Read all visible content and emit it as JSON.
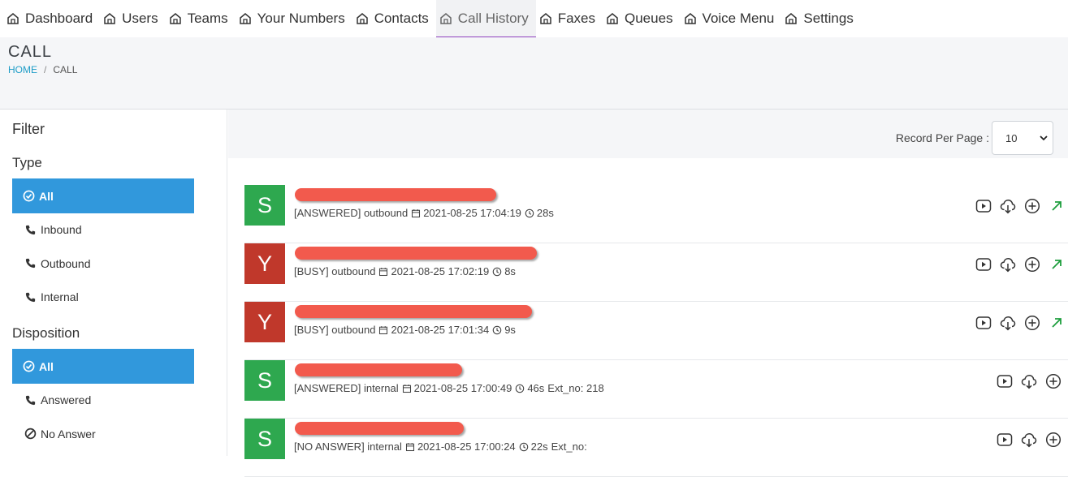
{
  "nav": {
    "items": [
      {
        "label": "Dashboard",
        "active": false
      },
      {
        "label": "Users",
        "active": false
      },
      {
        "label": "Teams",
        "active": false
      },
      {
        "label": "Your Numbers",
        "active": false
      },
      {
        "label": "Contacts",
        "active": false
      },
      {
        "label": "Call History",
        "active": true
      },
      {
        "label": "Faxes",
        "active": false
      },
      {
        "label": "Queues",
        "active": false
      },
      {
        "label": "Voice Menu",
        "active": false
      },
      {
        "label": "Settings",
        "active": false
      }
    ],
    "accent": "#8e3fbe"
  },
  "header": {
    "title": "CALL",
    "breadcrumb": {
      "home": "HOME",
      "separator": "/",
      "current": "CALL"
    }
  },
  "sidebar": {
    "filter_title": "Filter",
    "type": {
      "heading": "Type",
      "items": [
        {
          "label": "All",
          "icon": "check-circle-icon",
          "selected": true
        },
        {
          "label": "Inbound",
          "icon": "phone-icon",
          "selected": false
        },
        {
          "label": "Outbound",
          "icon": "phone-icon",
          "selected": false
        },
        {
          "label": "Internal",
          "icon": "phone-icon",
          "selected": false
        }
      ]
    },
    "disposition": {
      "heading": "Disposition",
      "items": [
        {
          "label": "All",
          "icon": "check-circle-icon",
          "selected": true
        },
        {
          "label": "Answered",
          "icon": "phone-icon",
          "selected": false
        },
        {
          "label": "No Answer",
          "icon": "ban-icon",
          "selected": false
        }
      ]
    },
    "selected_color": "#3198dc"
  },
  "toolbar": {
    "record_per_page_label": "Record Per Page :",
    "record_per_page_value": "10"
  },
  "calls": [
    {
      "avatar": "S",
      "avatar_color": "#2ea84f",
      "status": "[ANSWERED] outbound",
      "datetime": "2021-08-25 17:04:19",
      "duration": "28s",
      "extra": "",
      "outbound_arrow": true
    },
    {
      "avatar": "Y",
      "avatar_color": "#c0382b",
      "status": "[BUSY] outbound",
      "datetime": "2021-08-25 17:02:19",
      "duration": "8s",
      "extra": "",
      "outbound_arrow": true
    },
    {
      "avatar": "Y",
      "avatar_color": "#c0382b",
      "status": "[BUSY] outbound",
      "datetime": "2021-08-25 17:01:34",
      "duration": "9s",
      "extra": "",
      "outbound_arrow": true
    },
    {
      "avatar": "S",
      "avatar_color": "#2ea84f",
      "status": "[ANSWERED] internal",
      "datetime": "2021-08-25 17:00:49",
      "duration": "46s",
      "extra": "Ext_no: 218",
      "outbound_arrow": false
    },
    {
      "avatar": "S",
      "avatar_color": "#2ea84f",
      "status": "[NO ANSWER] internal",
      "datetime": "2021-08-25 17:00:24",
      "duration": "22s",
      "extra": "Ext_no:",
      "outbound_arrow": false
    }
  ],
  "row_icons": [
    "play-icon",
    "download-cloud-icon",
    "add-circle-icon",
    "outbound-arrow-icon"
  ]
}
